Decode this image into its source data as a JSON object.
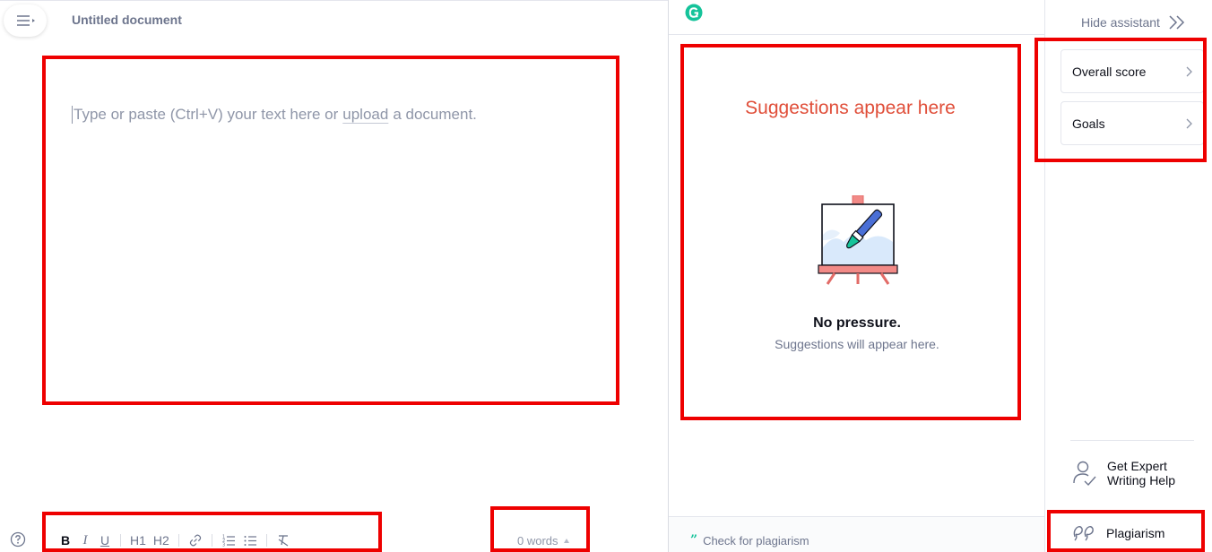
{
  "editor": {
    "document_title": "Untitled document",
    "placeholder_before": "Type or paste (Ctrl+V) your text here or",
    "placeholder_link": "upload",
    "placeholder_after": "a document.",
    "word_count": "0 words",
    "toolbar": {
      "bold": "B",
      "italic": "I",
      "underline": "U",
      "heading1": "H1",
      "heading2": "H2"
    }
  },
  "assistant": {
    "suggestions_hint": "Suggestions appear here",
    "empty_title": "No pressure.",
    "empty_subtitle": "Suggestions will appear here.",
    "check_plagiarism": "Check for plagiarism"
  },
  "sidebar": {
    "hide_assistant": "Hide assistant",
    "overall_score": "Overall score",
    "goals": "Goals",
    "expert_help": "Get Expert Writing Help",
    "plagiarism": "Plagiarism"
  },
  "colors": {
    "brand_green": "#15c39a",
    "annotation_red": "#ee0000",
    "hint_red": "#e04e39",
    "muted_text": "#6d758d"
  },
  "icons": [
    "menu-icon",
    "help-icon",
    "link-icon",
    "numbered-list-icon",
    "bulleted-list-icon",
    "clear-format-icon",
    "grammarly-logo-icon",
    "easel-brush-icon",
    "double-chevron-right-icon",
    "chevron-right-icon",
    "expert-user-icon",
    "plagiarism-quote-icon"
  ]
}
